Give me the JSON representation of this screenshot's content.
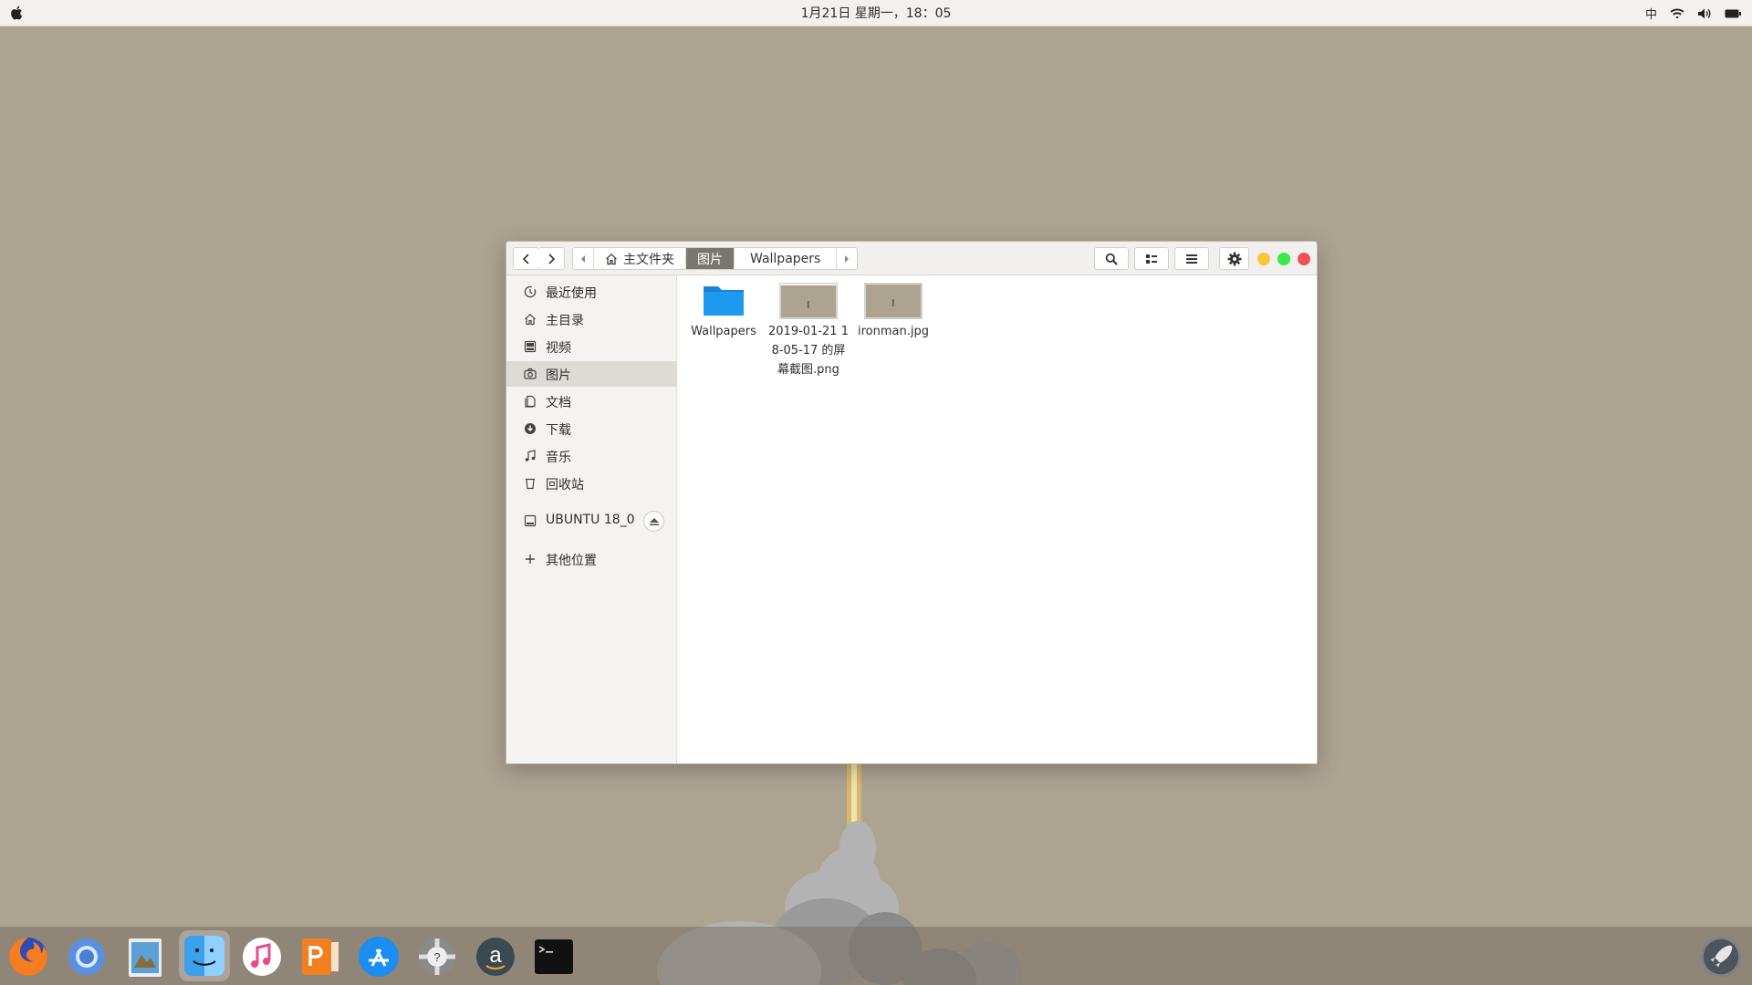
{
  "topbar": {
    "clock": "1月21日 星期一，18：05",
    "input_method": "中"
  },
  "window": {
    "breadcrumbs": [
      {
        "label": "主文件夹",
        "active": false
      },
      {
        "label": "图片",
        "active": true
      },
      {
        "label": "Wallpapers",
        "active": false
      }
    ]
  },
  "sidebar": {
    "items": [
      {
        "label": "最近使用",
        "icon": "clock-icon"
      },
      {
        "label": "主目录",
        "icon": "home-icon"
      },
      {
        "label": "视频",
        "icon": "film-icon"
      },
      {
        "label": "图片",
        "icon": "camera-icon",
        "selected": true
      },
      {
        "label": "文档",
        "icon": "document-icon"
      },
      {
        "label": "下载",
        "icon": "download-icon"
      },
      {
        "label": "音乐",
        "icon": "music-icon"
      },
      {
        "label": "回收站",
        "icon": "trash-icon"
      }
    ],
    "device": {
      "label": "UBUNTU 18_0",
      "icon": "drive-icon"
    },
    "other": {
      "label": "其他位置",
      "icon": "plus-icon"
    }
  },
  "files": [
    {
      "name": "Wallpapers",
      "type": "folder"
    },
    {
      "name": "2019-01-21 18-05-17 的屏幕截图.png",
      "type": "image"
    },
    {
      "name": "ironman.jpg",
      "type": "image"
    }
  ],
  "colors": {
    "wallpaper": "#ada391",
    "selection": "#7b7770",
    "close": "#f25056",
    "minimize": "#fac536",
    "maximize": "#39ea49",
    "folder": "#1e9bf0"
  }
}
